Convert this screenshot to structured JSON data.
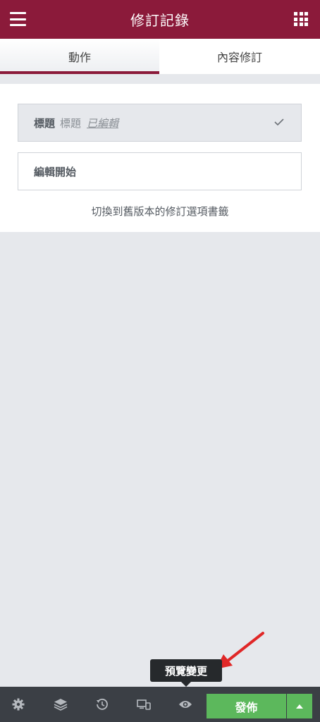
{
  "header": {
    "title": "修訂記錄",
    "menu_icon": "hamburger-menu-icon",
    "apps_icon": "grid-apps-icon"
  },
  "tabs": [
    {
      "label": "動作",
      "active": true
    },
    {
      "label": "內容修訂",
      "active": false
    }
  ],
  "history": {
    "current_item": {
      "bold": "標題",
      "sub": "標題",
      "action": "已編輯",
      "icon": "checkmark-icon"
    },
    "start_item": {
      "label": "編輯開始"
    },
    "switch_note": "切換到舊版本的修訂選項書籤"
  },
  "tooltip": {
    "text": "預覽變更"
  },
  "bottom_bar": {
    "icons": [
      "settings-gear-icon",
      "layers-icon",
      "history-icon",
      "responsive-devices-icon",
      "preview-eye-icon"
    ],
    "publish_label": "發佈",
    "publish_menu_icon": "caret-up-icon"
  },
  "colors": {
    "brand": "#8b1a3a",
    "publish_green": "#5cb85c",
    "bottom_bar": "#3b3f45",
    "annotation_arrow": "#e02727"
  }
}
